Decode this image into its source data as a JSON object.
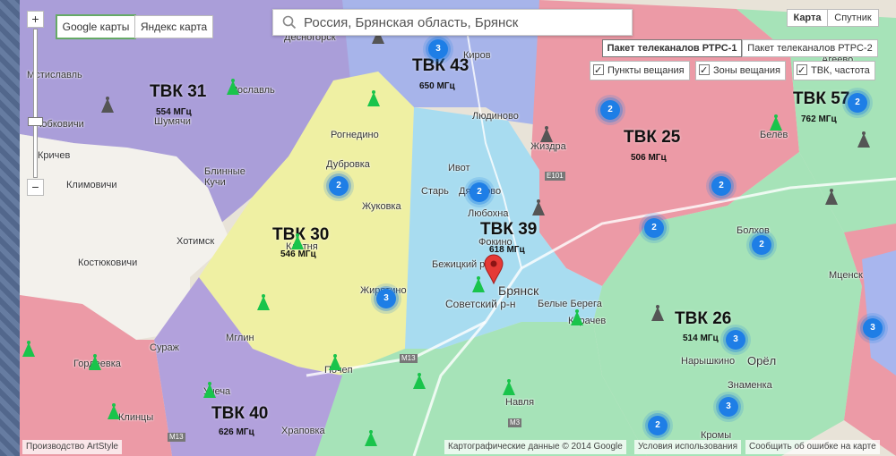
{
  "map_type_buttons": {
    "map": "Карта",
    "satellite": "Спутник"
  },
  "providers": {
    "google": "Google карты",
    "yandex": "Яндекс карта"
  },
  "search": {
    "value": "Россия, Брянская область, Брянск"
  },
  "packages": {
    "p1": "Пакет телеканалов РТРС-1",
    "p2": "Пакет телеканалов РТРС-2"
  },
  "layers": {
    "points": "Пункты вещания",
    "zones": "Зоны вещания",
    "tvk": "ТВК, частота"
  },
  "zoom": {
    "in": "+",
    "out": "−"
  },
  "zones": [
    {
      "tvk": "ТВК 31",
      "freq": "554 МГц"
    },
    {
      "tvk": "ТВК 43",
      "freq": "650 МГц"
    },
    {
      "tvk": "ТВК 25",
      "freq": "506 МГц"
    },
    {
      "tvk": "ТВК 57",
      "freq": "762 МГц"
    },
    {
      "tvk": "ТВК 30",
      "freq": "546 МГц"
    },
    {
      "tvk": "ТВК 39",
      "freq": "618 МГц"
    },
    {
      "tvk": "ТВК 26",
      "freq": "514 МГц"
    },
    {
      "tvk": "ТВК 40",
      "freq": "626 МГц"
    }
  ],
  "clusters": [
    "3",
    "2",
    "2",
    "2",
    "2",
    "2",
    "2",
    "3",
    "3",
    "2",
    "3",
    "2",
    "3"
  ],
  "places": [
    "Мстиславль",
    "Десногорск",
    "Киров",
    "Агеево",
    "Рославль",
    "Шумячи",
    "Людиново",
    "Кобковичи",
    "Рогнедино",
    "Жиздра",
    "Белёв",
    "Кричев",
    "Дубровка",
    "Ивот",
    "Климовичи",
    "Блинные Кучи",
    "Старь",
    "Дятьково",
    "Любохна",
    "Жуковка",
    "Болхов",
    "Хотимск",
    "Клетня",
    "Фокино",
    "Бежицкий р-н",
    "Костюковичи",
    "Брянск",
    "Советский р-н",
    "Белые Берега",
    "Жирятино",
    "Мценск",
    "Карачев",
    "Сураж",
    "Мглин",
    "Нарышкино",
    "Орёл",
    "Гордеевка",
    "Почеп",
    "Знаменка",
    "Унеча",
    "Навля",
    "Клинцы",
    "Храповка",
    "Кромы"
  ],
  "roads": [
    "Е101",
    "М13",
    "М3",
    "М13"
  ],
  "marker": "location-pin",
  "footer": {
    "left": "Производство ArtStyle",
    "data": "Картографические данные © 2014 Google",
    "terms": "Условия использования",
    "report": "Сообщить об ошибке на карте"
  }
}
